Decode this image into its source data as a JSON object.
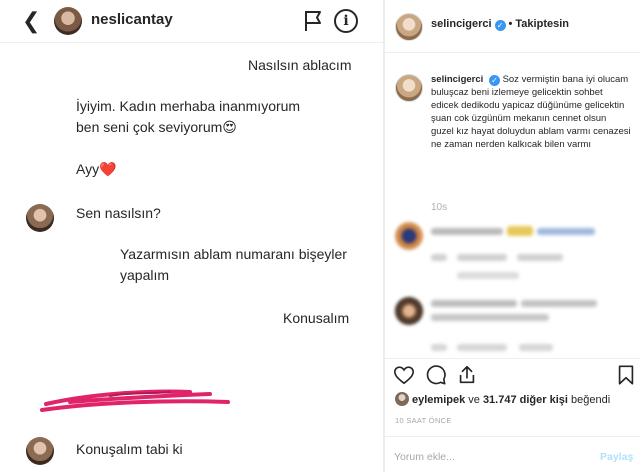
{
  "dm": {
    "username": "neslicantay",
    "messages": [
      {
        "side": "right",
        "text": "Nasılsın ablacım"
      },
      {
        "side": "left",
        "text": "İyiyim. Kadın merhaba inanmıyorum ben seni çok seviyorum😍"
      },
      {
        "side": "left",
        "text": "Ayy❤️"
      },
      {
        "side": "left",
        "text": "Sen nasılsın?"
      },
      {
        "side": "right",
        "text": "Yazarmısın ablam numaranı bişeyler yapalım"
      },
      {
        "side": "right",
        "text": "Konusalım"
      },
      {
        "side": "left",
        "text": "Konuşalım tabi ki"
      }
    ]
  },
  "post": {
    "username": "selincigerci",
    "follow_label": "Takiptesin",
    "caption_user": "selincigerci",
    "caption_text": "Soz vermiştin bana iyi olucam buluşcaz beni izlemeye gelicektin sohbet edicek dedikodu yapicaz düğünüme gelicektin şuan cok üzgünüm mekanın cennet olsun guzel kız hayat doluydun ablam varmı cenazesi ne zaman nerden kalkıcak bilen varmı",
    "caption_age": "10s",
    "likes_user": "eylemipek",
    "likes_middle": " ve ",
    "likes_count": "31.747 diğer kişi",
    "likes_suffix": " beğendi",
    "time_ago": "10 SAAT ÖNCE",
    "comment_placeholder": "Yorum ekle...",
    "share_label": "Paylaş",
    "accent": "#3897f0"
  }
}
